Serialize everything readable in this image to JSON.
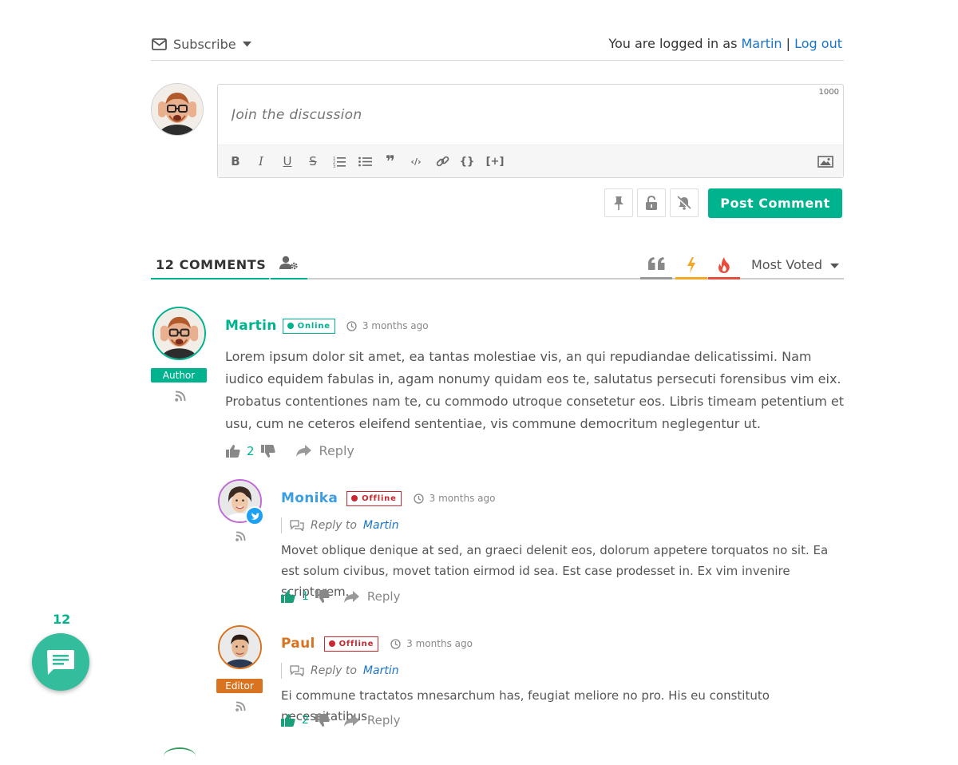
{
  "header": {
    "subscribe_label": "Subscribe",
    "logged_in_prefix": "You are logged in as",
    "user_name": "Martin",
    "separator": "|",
    "logout_label": "Log out"
  },
  "form": {
    "placeholder": "Join the discussion",
    "char_limit": "1000",
    "toolbar_icons": [
      "bold-icon",
      "italic-icon",
      "underline-icon",
      "strikethrough-icon",
      "ordered-list-icon",
      "unordered-list-icon",
      "quote-icon",
      "code-icon",
      "link-icon",
      "source-code-icon",
      "spoiler-icon",
      "image-icon"
    ],
    "tb_labels": {
      "bold": "B",
      "italic": "I",
      "underline": "U",
      "strike": "S",
      "quote": "❞",
      "code": "‹/›",
      "source": "{}",
      "spoiler": "[+]"
    },
    "post_label": "Post Comment"
  },
  "tabs": {
    "count_label": "12 COMMENTS",
    "sort_label": "Most Voted",
    "sort_icons": [
      "quotes-icon",
      "lightning-icon",
      "fire-icon"
    ],
    "colors": {
      "accent": "#00b38f",
      "lightning": "#f5a623",
      "fire": "#e74c3c",
      "gray": "#999999"
    }
  },
  "comments": [
    {
      "name": "Martin",
      "status": "Online",
      "time": "3 months ago",
      "role": "Author",
      "text": "Lorem ipsum dolor sit amet, ea tantas molestiae vis, an qui repudiandae delicatissimi. Nam iudico equidem fabulas in, agam nonumy quidam eos te, salutatus persecuti forensibus vim eix. Probatus contentiones nam te, cu commodo utroque consetetur eos. Libris timeam petentium et usu, cum ne ceteros eleifend sententiae, vis commune democritum neglegentur ut.",
      "votes": "2",
      "reply_label": "Reply"
    },
    {
      "name": "Monika",
      "status": "Offline",
      "time": "3 months ago",
      "reply_to_label": "Reply to",
      "reply_to_name": "Martin",
      "text": "Movet oblique denique at sed, an graeci delenit eos, dolorum appetere torquatos no sit. Ea est solum civibus, movet tation eirmod id sea. Est case prodesset in. Ex vim invenire scriptorem.",
      "votes": "1",
      "reply_label": "Reply"
    },
    {
      "name": "Paul",
      "status": "Offline",
      "time": "3 months ago",
      "role": "Editor",
      "reply_to_label": "Reply to",
      "reply_to_name": "Martin",
      "text": "Ei commune tractatos mnesarchum has, feugiat meliore no pro. His eu constituto necessitatibus.",
      "votes": "2",
      "reply_label": "Reply"
    }
  ],
  "bubble": {
    "count": "12",
    "icon": "chat-icon"
  }
}
